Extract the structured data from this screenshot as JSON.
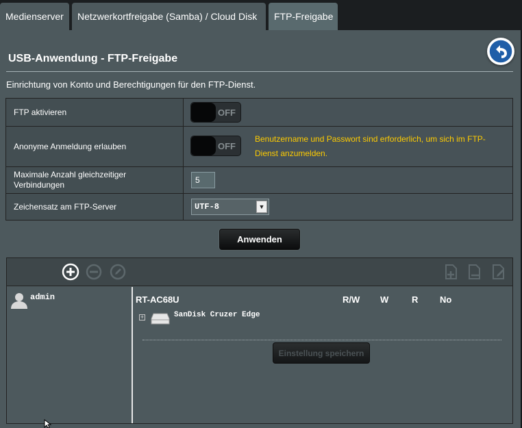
{
  "tabs": [
    {
      "label": "Medienserver"
    },
    {
      "label": "Netzwerkortfreigabe (Samba) / Cloud Disk"
    },
    {
      "label": "FTP-Freigabe"
    }
  ],
  "page": {
    "title": "USB-Anwendung - FTP-Freigabe",
    "subtitle": "Einrichtung von Konto und Berechtigungen für den FTP-Dienst."
  },
  "form": {
    "ftp_enable": {
      "label": "FTP aktivieren",
      "state": "OFF"
    },
    "anon_login": {
      "label": "Anonyme Anmeldung erlauben",
      "state": "OFF",
      "hint": "Benutzername und Passwort sind erforderlich, um sich im FTP-Dienst anzumelden."
    },
    "max_conn": {
      "label": "Maximale Anzahl gleichzeitiger Verbindungen",
      "value": "5"
    },
    "charset": {
      "label": "Zeichensatz am FTP-Server",
      "value": "UTF-8"
    },
    "apply_label": "Anwenden"
  },
  "accounts": {
    "users": [
      {
        "name": "admin"
      }
    ],
    "device": "RT-AC68U",
    "perm_columns": [
      "R/W",
      "W",
      "R",
      "No"
    ],
    "disk": "SanDisk Cruzer Edge",
    "save_label": "Einstellung speichern"
  },
  "colors": {
    "panel": "#4d595d",
    "hint": "#ffcc00",
    "accent": "#1f5ea8"
  }
}
